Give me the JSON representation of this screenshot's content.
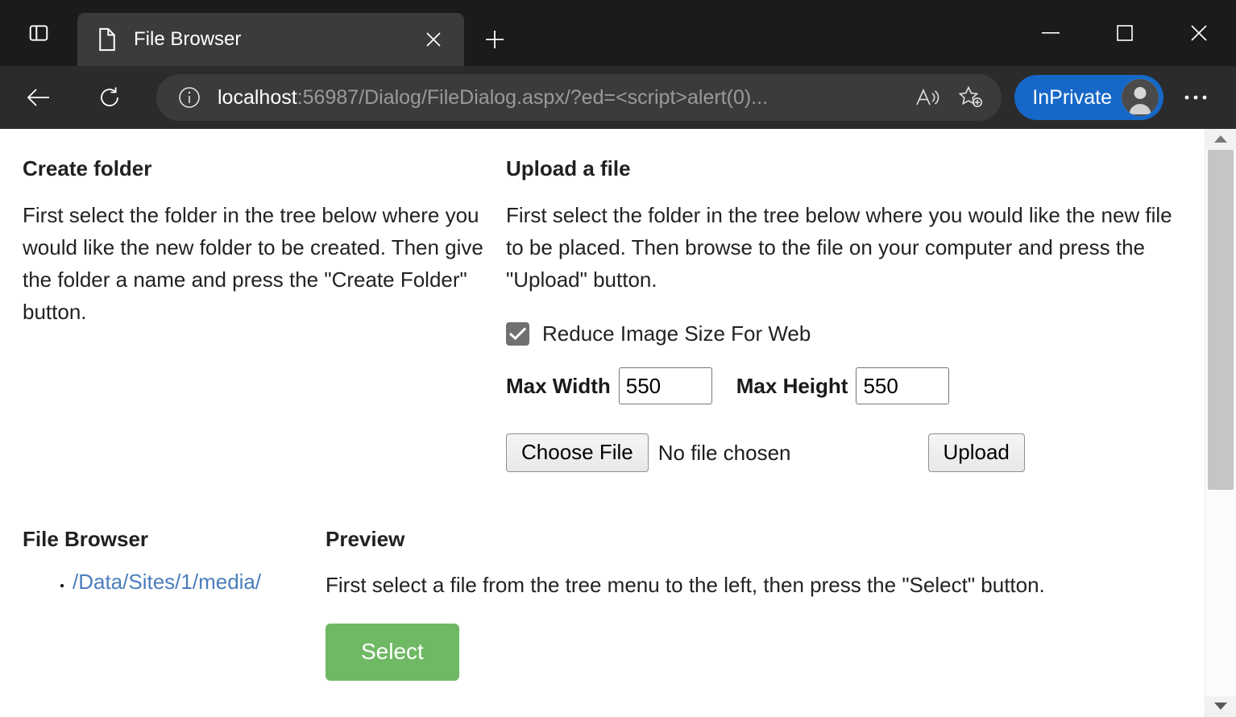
{
  "browser": {
    "sidebar_toggle_name": "Split screen / sidebar",
    "tab": {
      "title": "File Browser",
      "favicon": "document-icon",
      "close": "×"
    },
    "new_tab_label": "+",
    "window_controls": {
      "minimize": "minimize-icon",
      "maximize": "maximize-icon",
      "close": "close-icon"
    },
    "toolbar": {
      "back": "back-arrow-icon",
      "reload": "reload-icon",
      "site_info": "info-icon",
      "url_host": "localhost",
      "url_rest": ":56987/Dialog/FileDialog.aspx/?ed=<script>alert(0)...",
      "url_full": "localhost:56987/Dialog/FileDialog.aspx/?ed=<script>alert(0)...",
      "read_aloud": "read-aloud-icon",
      "favorites": "add-favorite-icon",
      "inprivate_label": "InPrivate",
      "settings_more": "ellipsis-icon"
    }
  },
  "page": {
    "create_folder": {
      "title": "Create folder",
      "description": "First select the folder in the tree below where you would like the new folder to be created. Then give the folder a name and press the \"Create Folder\" button."
    },
    "upload": {
      "title": "Upload a file",
      "description": "First select the folder in the tree below where you would like the new file to be placed. Then browse to the file on your computer and press the \"Upload\" button.",
      "reduce_label": "Reduce Image Size For Web",
      "reduce_checked": true,
      "max_width_label": "Max Width",
      "max_width_value": "550",
      "max_height_label": "Max Height",
      "max_height_value": "550",
      "choose_file_label": "Choose File",
      "no_file_text": "No file chosen",
      "upload_label": "Upload"
    },
    "file_browser": {
      "title": "File Browser",
      "items": [
        {
          "label": "/Data/Sites/1/media/"
        }
      ]
    },
    "preview": {
      "title": "Preview",
      "description": "First select a file from the tree menu to the left, then press the \"Select\" button.",
      "select_label": "Select"
    }
  },
  "colors": {
    "accent_blue": "#1668c8",
    "select_green": "#6fb964",
    "link_blue": "#4a7ebb",
    "checkbox_gray": "#707070",
    "chrome_dark": "#2b2b2b",
    "tabstrip_dark": "#1b1b1b"
  },
  "scrollbar": {
    "up_arrow": "▲",
    "down_arrow": "▼"
  }
}
